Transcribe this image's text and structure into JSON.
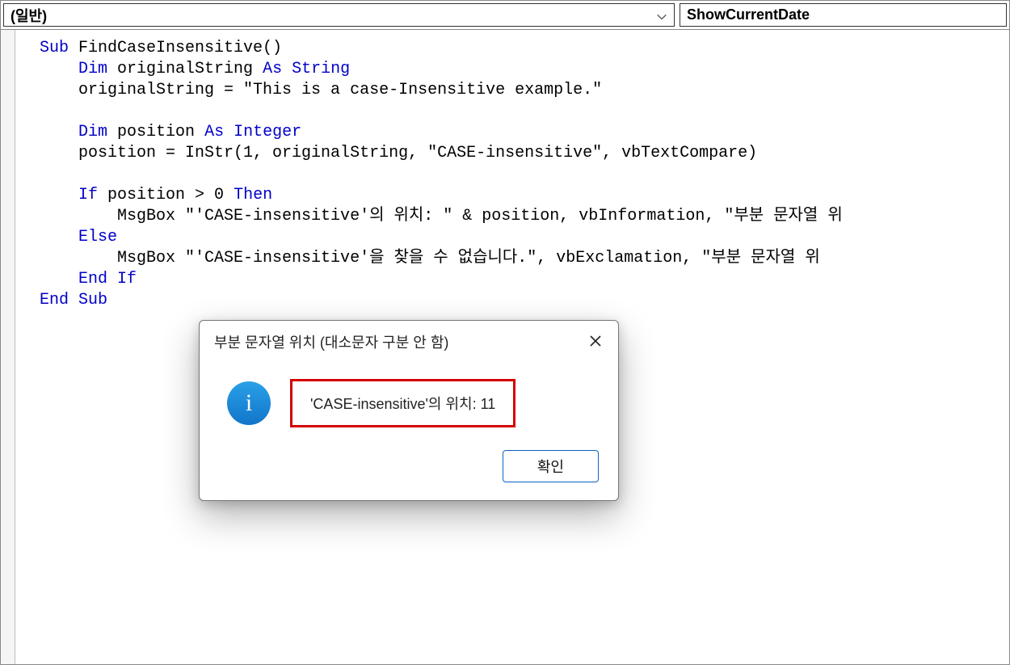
{
  "header": {
    "left_dropdown": "(일반)",
    "right_dropdown": "ShowCurrentDate"
  },
  "code": {
    "l1a": "Sub",
    "l1b": " FindCaseInsensitive()",
    "l2a": "    ",
    "l2b": "Dim",
    "l2c": " originalString ",
    "l2d": "As String",
    "l3": "    originalString = \"This is a case-Insensitive example.\"",
    "l4": "",
    "l5a": "    ",
    "l5b": "Dim",
    "l5c": " position ",
    "l5d": "As Integer",
    "l6": "    position = InStr(1, originalString, \"CASE-insensitive\", vbTextCompare)",
    "l7": "",
    "l8a": "    ",
    "l8b": "If",
    "l8c": " position > 0 ",
    "l8d": "Then",
    "l9": "        MsgBox \"'CASE-insensitive'의 위치: \" & position, vbInformation, \"부분 문자열 위",
    "l10a": "    ",
    "l10b": "Else",
    "l11": "        MsgBox \"'CASE-insensitive'을 찾을 수 없습니다.\", vbExclamation, \"부분 문자열 위",
    "l12a": "    ",
    "l12b": "End If",
    "l13a": "",
    "l13b": "End Sub"
  },
  "dialog": {
    "title": "부분 문자열 위치 (대소문자 구분 안 함)",
    "message": "'CASE-insensitive'의 위치: 11",
    "ok_label": "확인",
    "info_glyph": "i"
  }
}
